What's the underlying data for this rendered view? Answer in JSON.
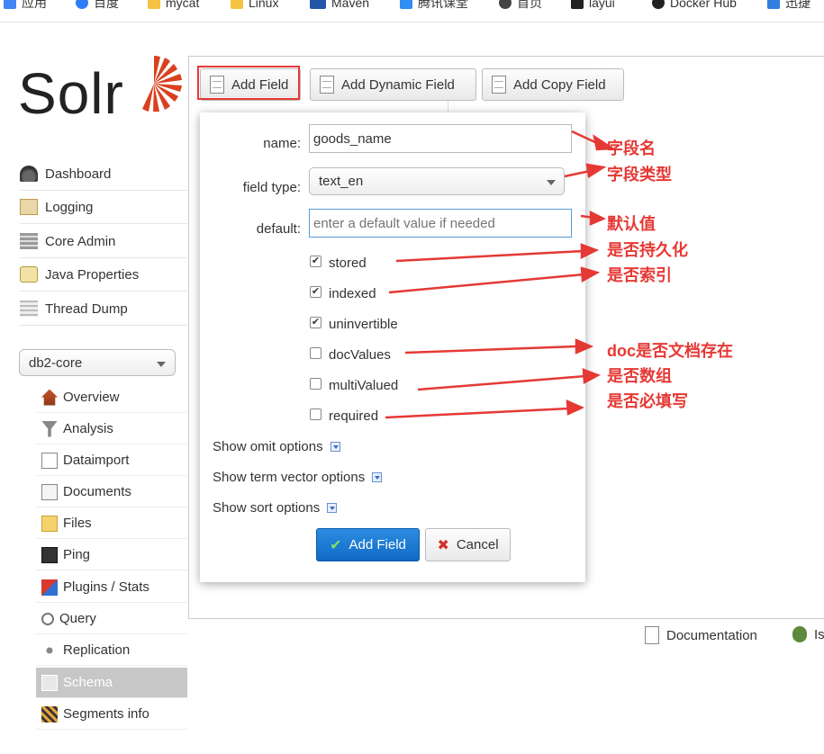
{
  "bookmarks": [
    {
      "label": "应用",
      "icon": "apps-icon",
      "color": "#4285f4"
    },
    {
      "label": "百度",
      "icon": "baidu-icon",
      "color": "#2e7df7"
    },
    {
      "label": "mycat",
      "icon": "folder-icon",
      "color": "#f5c342"
    },
    {
      "label": "Linux",
      "icon": "folder-icon",
      "color": "#f5c342"
    },
    {
      "label": "Maven",
      "icon": "maven-icon",
      "color": "#2257a8"
    },
    {
      "label": "腾讯课堂",
      "icon": "tencent-class-icon",
      "color": "#2f8ff2"
    },
    {
      "label": "首页",
      "icon": "home-globe-icon",
      "color": "#444"
    },
    {
      "label": "layui",
      "icon": "layui-icon",
      "color": "#222"
    },
    {
      "label": "Docker Hub",
      "icon": "github-icon",
      "color": "#222"
    },
    {
      "label": "迅捷",
      "icon": "xunjie-icon",
      "color": "#2f7fe0"
    }
  ],
  "logo": {
    "text": "Solr",
    "accent": "#d9411e"
  },
  "nav": [
    {
      "label": "Dashboard",
      "icon": "dashboard-icon"
    },
    {
      "label": "Logging",
      "icon": "logging-icon"
    },
    {
      "label": "Core Admin",
      "icon": "core-admin-icon"
    },
    {
      "label": "Java Properties",
      "icon": "java-icon"
    },
    {
      "label": "Thread Dump",
      "icon": "thread-dump-icon"
    }
  ],
  "core_selector": {
    "value": "db2-core"
  },
  "core_menu": [
    {
      "label": "Overview",
      "icon": "home-icon"
    },
    {
      "label": "Analysis",
      "icon": "funnel-icon"
    },
    {
      "label": "Dataimport",
      "icon": "dataimport-icon"
    },
    {
      "label": "Documents",
      "icon": "documents-icon"
    },
    {
      "label": "Files",
      "icon": "files-icon"
    },
    {
      "label": "Ping",
      "icon": "ping-icon"
    },
    {
      "label": "Plugins / Stats",
      "icon": "plugins-icon"
    },
    {
      "label": "Query",
      "icon": "search-icon"
    },
    {
      "label": "Replication",
      "icon": "replication-icon"
    },
    {
      "label": "Schema",
      "icon": "schema-icon",
      "active": true
    },
    {
      "label": "Segments info",
      "icon": "segments-icon"
    }
  ],
  "toolbar": {
    "add_field": "Add Field",
    "add_dynamic_field": "Add Dynamic Field",
    "add_copy_field": "Add Copy Field"
  },
  "form": {
    "name_label": "name:",
    "name_value": "goods_name",
    "field_type_label": "field type:",
    "field_type_value": "text_en",
    "default_label": "default:",
    "default_placeholder": "enter a default value if needed",
    "checkboxes": [
      {
        "label": "stored",
        "checked": true
      },
      {
        "label": "indexed",
        "checked": true
      },
      {
        "label": "uninvertible",
        "checked": true
      },
      {
        "label": "docValues",
        "checked": false
      },
      {
        "label": "multiValued",
        "checked": false
      },
      {
        "label": "required",
        "checked": false
      }
    ],
    "show_omit": "Show omit options",
    "show_term_vector": "Show term vector options",
    "show_sort": "Show sort options",
    "submit": "Add Field",
    "cancel": "Cancel"
  },
  "annotations": {
    "name": "字段名",
    "field_type": "字段类型",
    "default": "默认值",
    "stored": "是否持久化",
    "indexed": "是否索引",
    "docvalues": "doc是否文档存在",
    "multivalued": "是否数组",
    "required": "是否必填写",
    "color": "#e53935"
  },
  "footer": {
    "documentation": "Documentation",
    "issues": "Is"
  }
}
